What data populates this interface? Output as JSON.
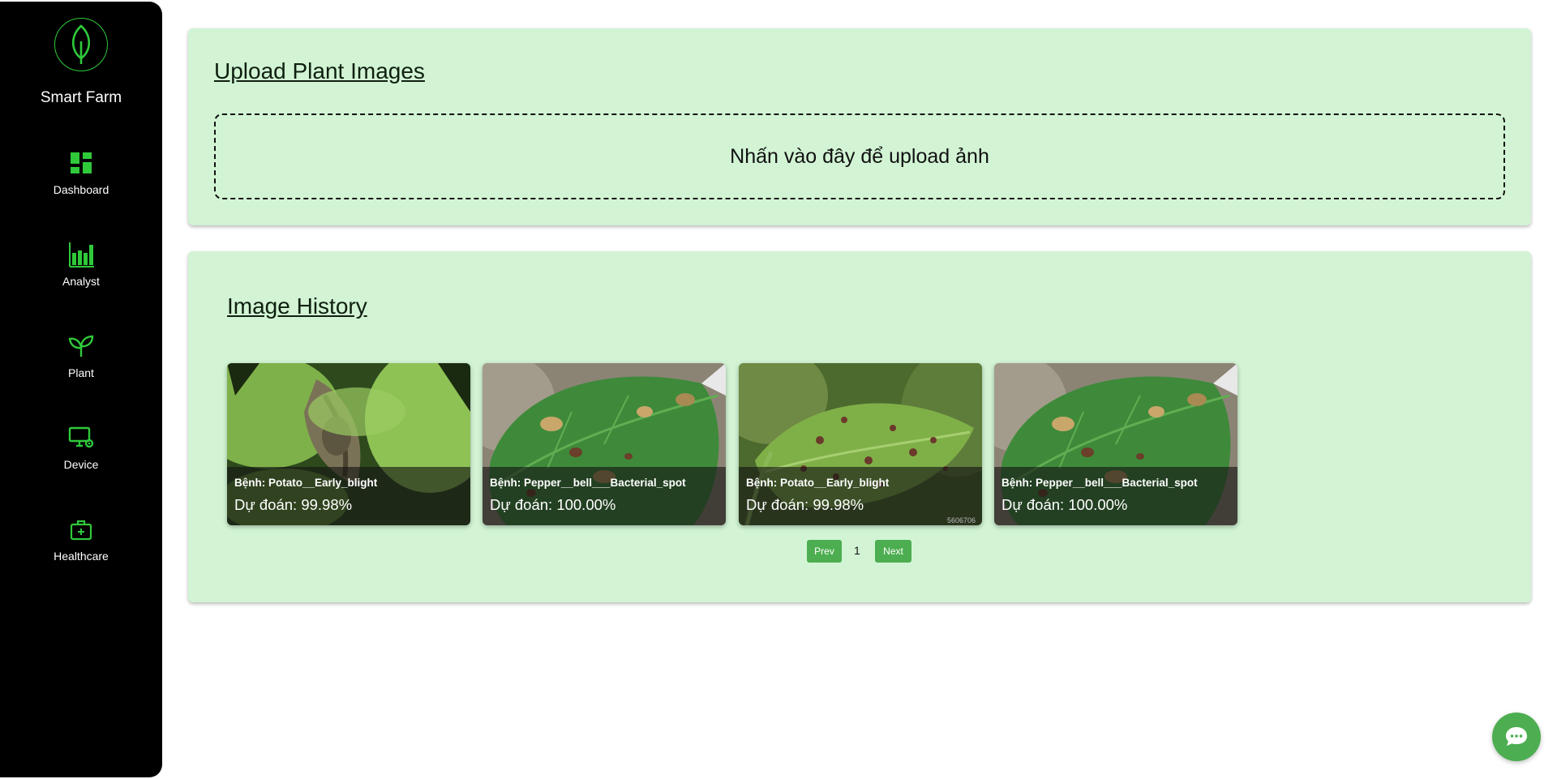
{
  "app": {
    "name": "Smart Farm"
  },
  "sidebar": {
    "items": [
      {
        "label": "Dashboard",
        "icon": "dashboard-icon"
      },
      {
        "label": "Analyst",
        "icon": "bar-chart-icon"
      },
      {
        "label": "Plant",
        "icon": "sprout-icon"
      },
      {
        "label": "Device",
        "icon": "monitor-gear-icon"
      },
      {
        "label": "Healthcare",
        "icon": "medical-kit-icon"
      }
    ]
  },
  "upload": {
    "title": "Upload Plant Images",
    "dropzone_text": "Nhấn vào đây để upload ảnh"
  },
  "history": {
    "title": "Image History",
    "items": [
      {
        "disease": "Bệnh: Potato__Early_blight",
        "prediction": "Dự đoán: 99.98%"
      },
      {
        "disease": "Bệnh: Pepper__bell___Bacterial_spot",
        "prediction": "Dự đoán: 100.00%"
      },
      {
        "disease": "Bệnh: Potato__Early_blight",
        "prediction": "Dự đoán: 99.98%",
        "watermark": "5606706"
      },
      {
        "disease": "Bệnh: Pepper__bell___Bacterial_spot",
        "prediction": "Dự đoán: 100.00%"
      }
    ],
    "pagination": {
      "prev_label": "Prev",
      "current_page": "1",
      "next_label": "Next"
    }
  },
  "theme": {
    "accent": "#2fc93a",
    "card_bg": "#d2f4d4",
    "button": "#4cae50"
  }
}
